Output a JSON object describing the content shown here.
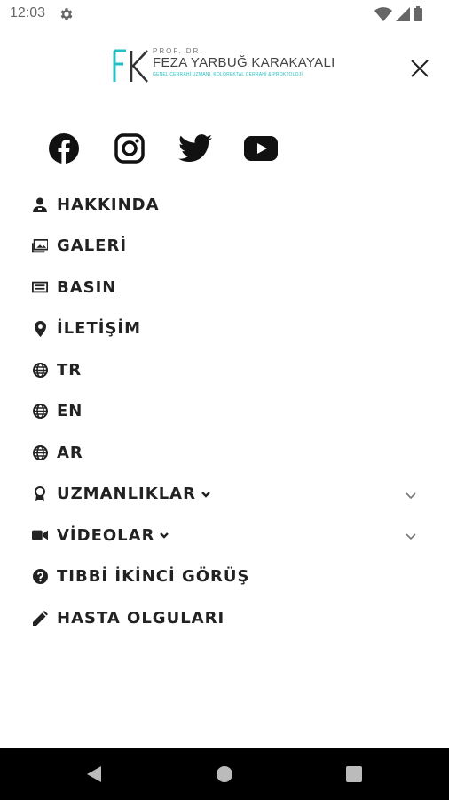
{
  "status_bar": {
    "time": "12:03"
  },
  "header": {
    "logo_prefix": "PROF. DR.",
    "logo_name": "FEZA YARBUĞ KARAKAYALI",
    "logo_tagline": "GENEL CERRAHİ UZMANI, KOLOREKTAL CERRAHİ & PROKTOLOJİ",
    "brand_color": "#23c0c4"
  },
  "social": [
    {
      "icon": "facebook-icon"
    },
    {
      "icon": "instagram-icon"
    },
    {
      "icon": "twitter-icon"
    },
    {
      "icon": "youtube-icon"
    }
  ],
  "menu": {
    "items": [
      {
        "label": "HAKKINDA",
        "icon": "doctor-icon"
      },
      {
        "label": "GALERİ",
        "icon": "images-icon"
      },
      {
        "label": "BASIN",
        "icon": "newspaper-icon"
      },
      {
        "label": "İLETİŞİM",
        "icon": "location-pin-icon"
      },
      {
        "label": "TR",
        "icon": "globe-icon"
      },
      {
        "label": "EN",
        "icon": "globe-icon"
      },
      {
        "label": "AR",
        "icon": "globe-icon"
      },
      {
        "label": "UZMANLIKLAR",
        "icon": "award-icon",
        "expandable": true
      },
      {
        "label": "VİDEOLAR",
        "icon": "video-camera-icon",
        "expandable": true
      },
      {
        "label": "TIBBİ İKİNCİ GÖRÜŞ",
        "icon": "question-circle-icon"
      },
      {
        "label": "HASTA OLGULARI",
        "icon": "pencil-icon"
      }
    ]
  }
}
